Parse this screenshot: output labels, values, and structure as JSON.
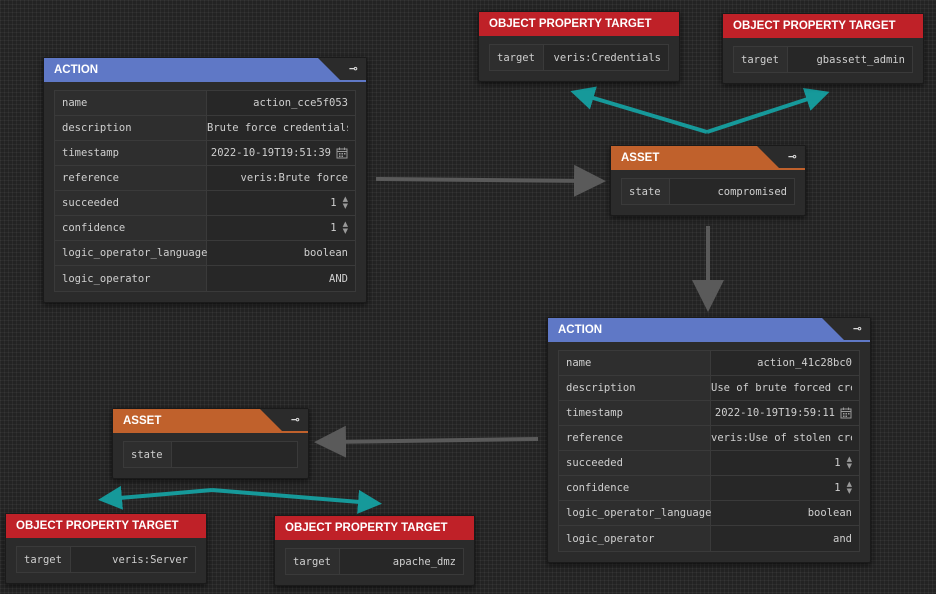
{
  "colors": {
    "action_header": "#5f78c6",
    "asset_header": "#c0612c",
    "target_header": "#bf2128",
    "edge_gray": "#5a5a5a",
    "edge_teal": "#16999a",
    "background": "#232323"
  },
  "icons": {
    "header_plug": "plug-icon",
    "timestamp": "calendar-icon",
    "number": "spinner-icon"
  },
  "action1": {
    "header": "ACTION",
    "rows": [
      {
        "key": "name",
        "value": "action_cce5f053"
      },
      {
        "key": "description",
        "value": "Brute force credentials"
      },
      {
        "key": "timestamp",
        "value": "2022-10-19T19:51:39"
      },
      {
        "key": "reference",
        "value": "veris:Brute force"
      },
      {
        "key": "succeeded",
        "value": "1"
      },
      {
        "key": "confidence",
        "value": "1"
      },
      {
        "key": "logic_operator_language",
        "value": "boolean"
      },
      {
        "key": "logic_operator",
        "value": "AND"
      }
    ]
  },
  "asset1": {
    "header": "ASSET",
    "rows": [
      {
        "key": "state",
        "value": "compromised"
      }
    ]
  },
  "target1": {
    "header": "OBJECT PROPERTY TARGET",
    "rows": [
      {
        "key": "target",
        "value": "veris:Credentials"
      }
    ]
  },
  "target2": {
    "header": "OBJECT PROPERTY TARGET",
    "rows": [
      {
        "key": "target",
        "value": "gbassett_admin"
      }
    ]
  },
  "action2": {
    "header": "ACTION",
    "rows": [
      {
        "key": "name",
        "value": "action_41c28bc0"
      },
      {
        "key": "description",
        "value": "Use of brute forced creds"
      },
      {
        "key": "timestamp",
        "value": "2022-10-19T19:59:11"
      },
      {
        "key": "reference",
        "value": "veris:Use of stolen creds"
      },
      {
        "key": "succeeded",
        "value": "1"
      },
      {
        "key": "confidence",
        "value": "1"
      },
      {
        "key": "logic_operator_language",
        "value": "boolean"
      },
      {
        "key": "logic_operator",
        "value": "and"
      }
    ]
  },
  "asset2": {
    "header": "ASSET",
    "rows": [
      {
        "key": "state",
        "value": ""
      }
    ]
  },
  "target3": {
    "header": "OBJECT PROPERTY TARGET",
    "rows": [
      {
        "key": "target",
        "value": "veris:Server"
      }
    ]
  },
  "target4": {
    "header": "OBJECT PROPERTY TARGET",
    "rows": [
      {
        "key": "target",
        "value": "apache_dmz"
      }
    ]
  }
}
